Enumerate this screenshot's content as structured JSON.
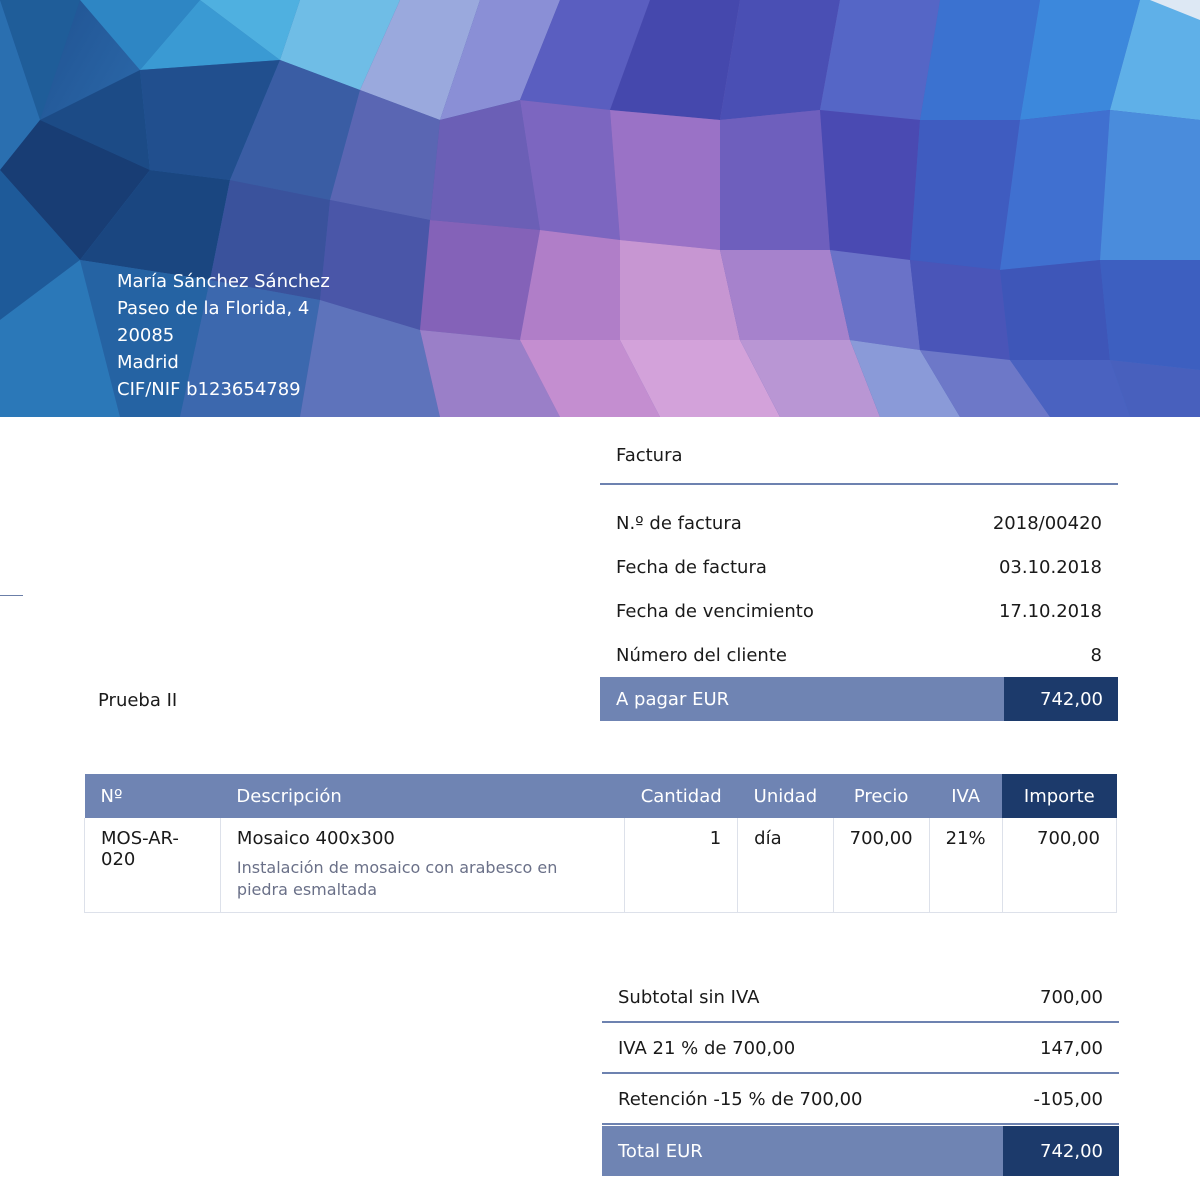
{
  "sender": {
    "name": "María Sánchez Sánchez",
    "street": "Paseo de la Florida, 4",
    "zip": "20085",
    "city": "Madrid",
    "tax_id": "CIF/NIF b123654789"
  },
  "invoice": {
    "title": "Factura",
    "rows": [
      {
        "label": "N.º de factura",
        "value": "2018/00420"
      },
      {
        "label": "Fecha de factura",
        "value": "03.10.2018"
      },
      {
        "label": "Fecha de vencimiento",
        "value": "17.10.2018"
      },
      {
        "label": "Número del cliente",
        "value": "8"
      }
    ],
    "pay_label": "A pagar EUR",
    "pay_value": "742,00"
  },
  "client": {
    "name": "Prueba II"
  },
  "items": {
    "headers": {
      "num": "Nº",
      "desc": "Descripción",
      "qty": "Cantidad",
      "unit": "Unidad",
      "price": "Precio",
      "vat": "IVA",
      "amount": "Importe"
    },
    "rows": [
      {
        "num": "MOS-AR-020",
        "title": "Mosaico 400x300",
        "description": "Instalación de mosaico con arabesco en piedra esmaltada",
        "qty": "1",
        "unit": "día",
        "price": "700,00",
        "vat": "21%",
        "amount": "700,00"
      }
    ]
  },
  "totals": {
    "rows": [
      {
        "label": "Subtotal sin IVA",
        "value": "700,00"
      },
      {
        "label": "IVA 21 % de 700,00",
        "value": "147,00"
      },
      {
        "label": "Retención -15 % de 700,00",
        "value": "-105,00"
      }
    ],
    "total_label": "Total EUR",
    "total_value": "742,00"
  }
}
